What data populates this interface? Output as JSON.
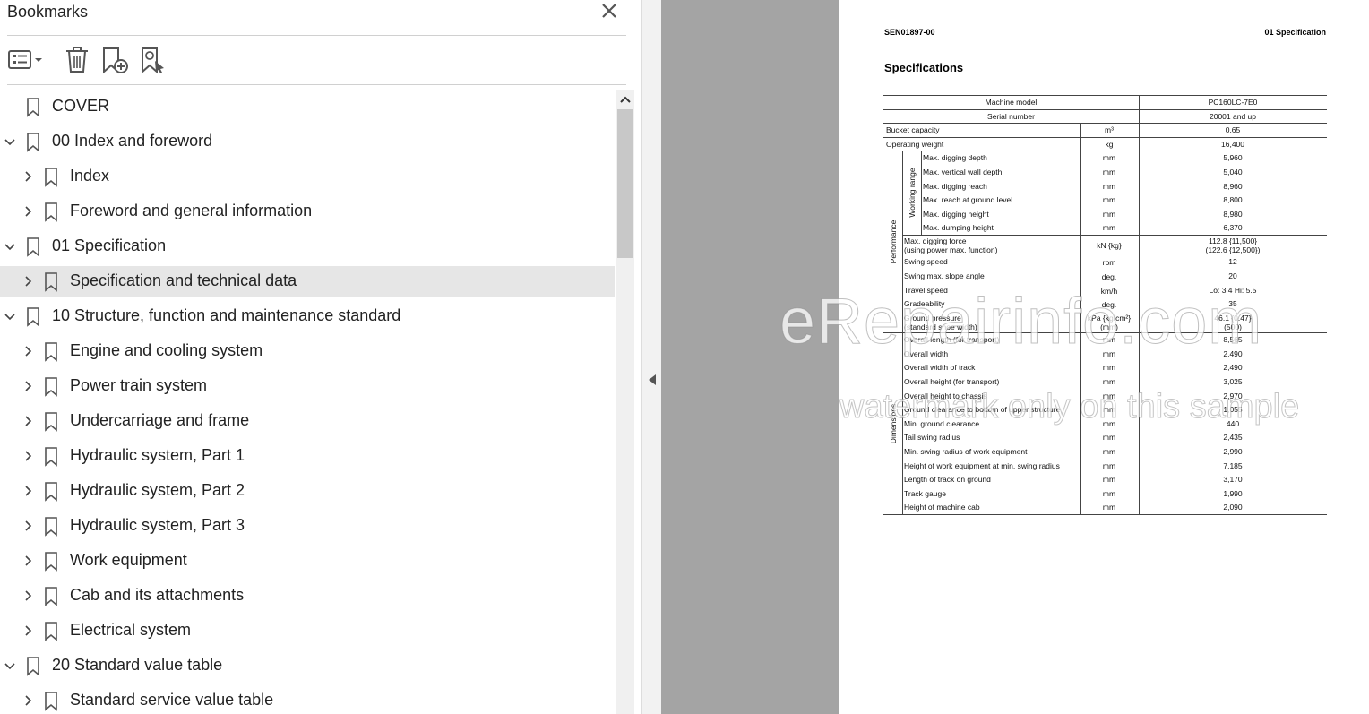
{
  "panel": {
    "title": "Bookmarks",
    "close_label": "×"
  },
  "toolbar": {
    "options_icon": "options-menu-icon",
    "delete_icon": "trash-icon",
    "add_icon": "add-bookmark-icon",
    "find_icon": "find-current-bookmark-icon"
  },
  "bookmarks": [
    {
      "label": "COVER",
      "level": 0,
      "expander": "none",
      "selected": false
    },
    {
      "label": "00 Index and foreword",
      "level": 0,
      "expander": "expanded",
      "selected": false
    },
    {
      "label": "Index",
      "level": 1,
      "expander": "collapsed",
      "selected": false
    },
    {
      "label": "Foreword and general information",
      "level": 1,
      "expander": "collapsed",
      "selected": false
    },
    {
      "label": "01 Specification",
      "level": 0,
      "expander": "expanded",
      "selected": false
    },
    {
      "label": "Specification and technical data",
      "level": 1,
      "expander": "collapsed",
      "selected": true
    },
    {
      "label": "10 Structure, function and maintenance standard",
      "level": 0,
      "expander": "expanded",
      "selected": false
    },
    {
      "label": "Engine and cooling system",
      "level": 1,
      "expander": "collapsed",
      "selected": false
    },
    {
      "label": "Power train system",
      "level": 1,
      "expander": "collapsed",
      "selected": false
    },
    {
      "label": "Undercarriage and frame",
      "level": 1,
      "expander": "collapsed",
      "selected": false
    },
    {
      "label": "Hydraulic system, Part 1",
      "level": 1,
      "expander": "collapsed",
      "selected": false
    },
    {
      "label": "Hydraulic system, Part 2",
      "level": 1,
      "expander": "collapsed",
      "selected": false
    },
    {
      "label": "Hydraulic system, Part 3",
      "level": 1,
      "expander": "collapsed",
      "selected": false
    },
    {
      "label": "Work equipment",
      "level": 1,
      "expander": "collapsed",
      "selected": false
    },
    {
      "label": "Cab and its attachments",
      "level": 1,
      "expander": "collapsed",
      "selected": false
    },
    {
      "label": "Electrical system",
      "level": 1,
      "expander": "collapsed",
      "selected": false
    },
    {
      "label": "20 Standard value table",
      "level": 0,
      "expander": "expanded",
      "selected": false
    },
    {
      "label": "Standard service value table",
      "level": 1,
      "expander": "collapsed",
      "selected": false
    }
  ],
  "document": {
    "code": "SEN01897-00",
    "section": "01 Specification",
    "heading": "Specifications",
    "header_rows": [
      {
        "label": "Machine model",
        "value": "PC160LC-7E0"
      },
      {
        "label": "Serial number",
        "value": "20001 and up"
      }
    ],
    "top_rows": [
      {
        "label": "Bucket capacity",
        "unit": "m³",
        "value": "0.65"
      },
      {
        "label": "Operating weight",
        "unit": "kg",
        "value": "16,400"
      }
    ],
    "group_performance": "Performance",
    "group_working_range": "Working range",
    "group_dimensions": "Dimensions",
    "working_range_rows": [
      {
        "label": "Max. digging depth",
        "unit": "mm",
        "value": "5,960"
      },
      {
        "label": "Max. vertical wall depth",
        "unit": "mm",
        "value": "5,040"
      },
      {
        "label": "Max. digging reach",
        "unit": "mm",
        "value": "8,960"
      },
      {
        "label": "Max. reach at ground level",
        "unit": "mm",
        "value": "8,800"
      },
      {
        "label": "Max. digging height",
        "unit": "mm",
        "value": "8,980"
      },
      {
        "label": "Max. dumping height",
        "unit": "mm",
        "value": "6,370"
      }
    ],
    "performance_rows": [
      {
        "label": "Max. digging force",
        "label2": "(using power max. function)",
        "unit": "kN {kg}",
        "value": "112.8 {11,500}",
        "value2": "(122.6 {12,500})"
      },
      {
        "label": "Swing speed",
        "unit": "rpm",
        "value": "12"
      },
      {
        "label": "Swing max. slope angle",
        "unit": "deg.",
        "value": "20"
      },
      {
        "label": "Travel speed",
        "unit": "km/h",
        "value": "Lo: 3.4  Hi: 5.5"
      },
      {
        "label": "Gradeability",
        "unit": "deg.",
        "value": "35"
      },
      {
        "label": "Ground pressure",
        "label2": "(standard shoe width)",
        "unit": "kPa {kg/cm²}",
        "unit2": "(mm)",
        "value": "46.1 {0.47}",
        "value2": "(500)"
      }
    ],
    "dimension_rows": [
      {
        "label": "Overall length (for transport)",
        "unit": "mm",
        "value": "8,565"
      },
      {
        "label": "Overall width",
        "unit": "mm",
        "value": "2,490"
      },
      {
        "label": "Overall width of track",
        "unit": "mm",
        "value": "2,490"
      },
      {
        "label": "Overall height (for transport)",
        "unit": "mm",
        "value": "3,025"
      },
      {
        "label": "Overall height to chassis",
        "unit": "mm",
        "value": "2,970"
      },
      {
        "label": "Ground clearance to bottom of upper structure",
        "unit": "mm",
        "value": "1,055"
      },
      {
        "label": "Min. ground clearance",
        "unit": "mm",
        "value": "440"
      },
      {
        "label": "Tail swing radius",
        "unit": "mm",
        "value": "2,435"
      },
      {
        "label": "Min. swing radius of work equipment",
        "unit": "mm",
        "value": "2,990"
      },
      {
        "label": "Height of work equipment at min. swing radius",
        "unit": "mm",
        "value": "7,185"
      },
      {
        "label": "Length of track on ground",
        "unit": "mm",
        "value": "3,170"
      },
      {
        "label": "Track gauge",
        "unit": "mm",
        "value": "1,990"
      },
      {
        "label": "Height of machine cab",
        "unit": "mm",
        "value": "2,090"
      }
    ],
    "watermark_main": "eRepairinfo.com",
    "watermark_sub": "watermark only on this sample"
  }
}
